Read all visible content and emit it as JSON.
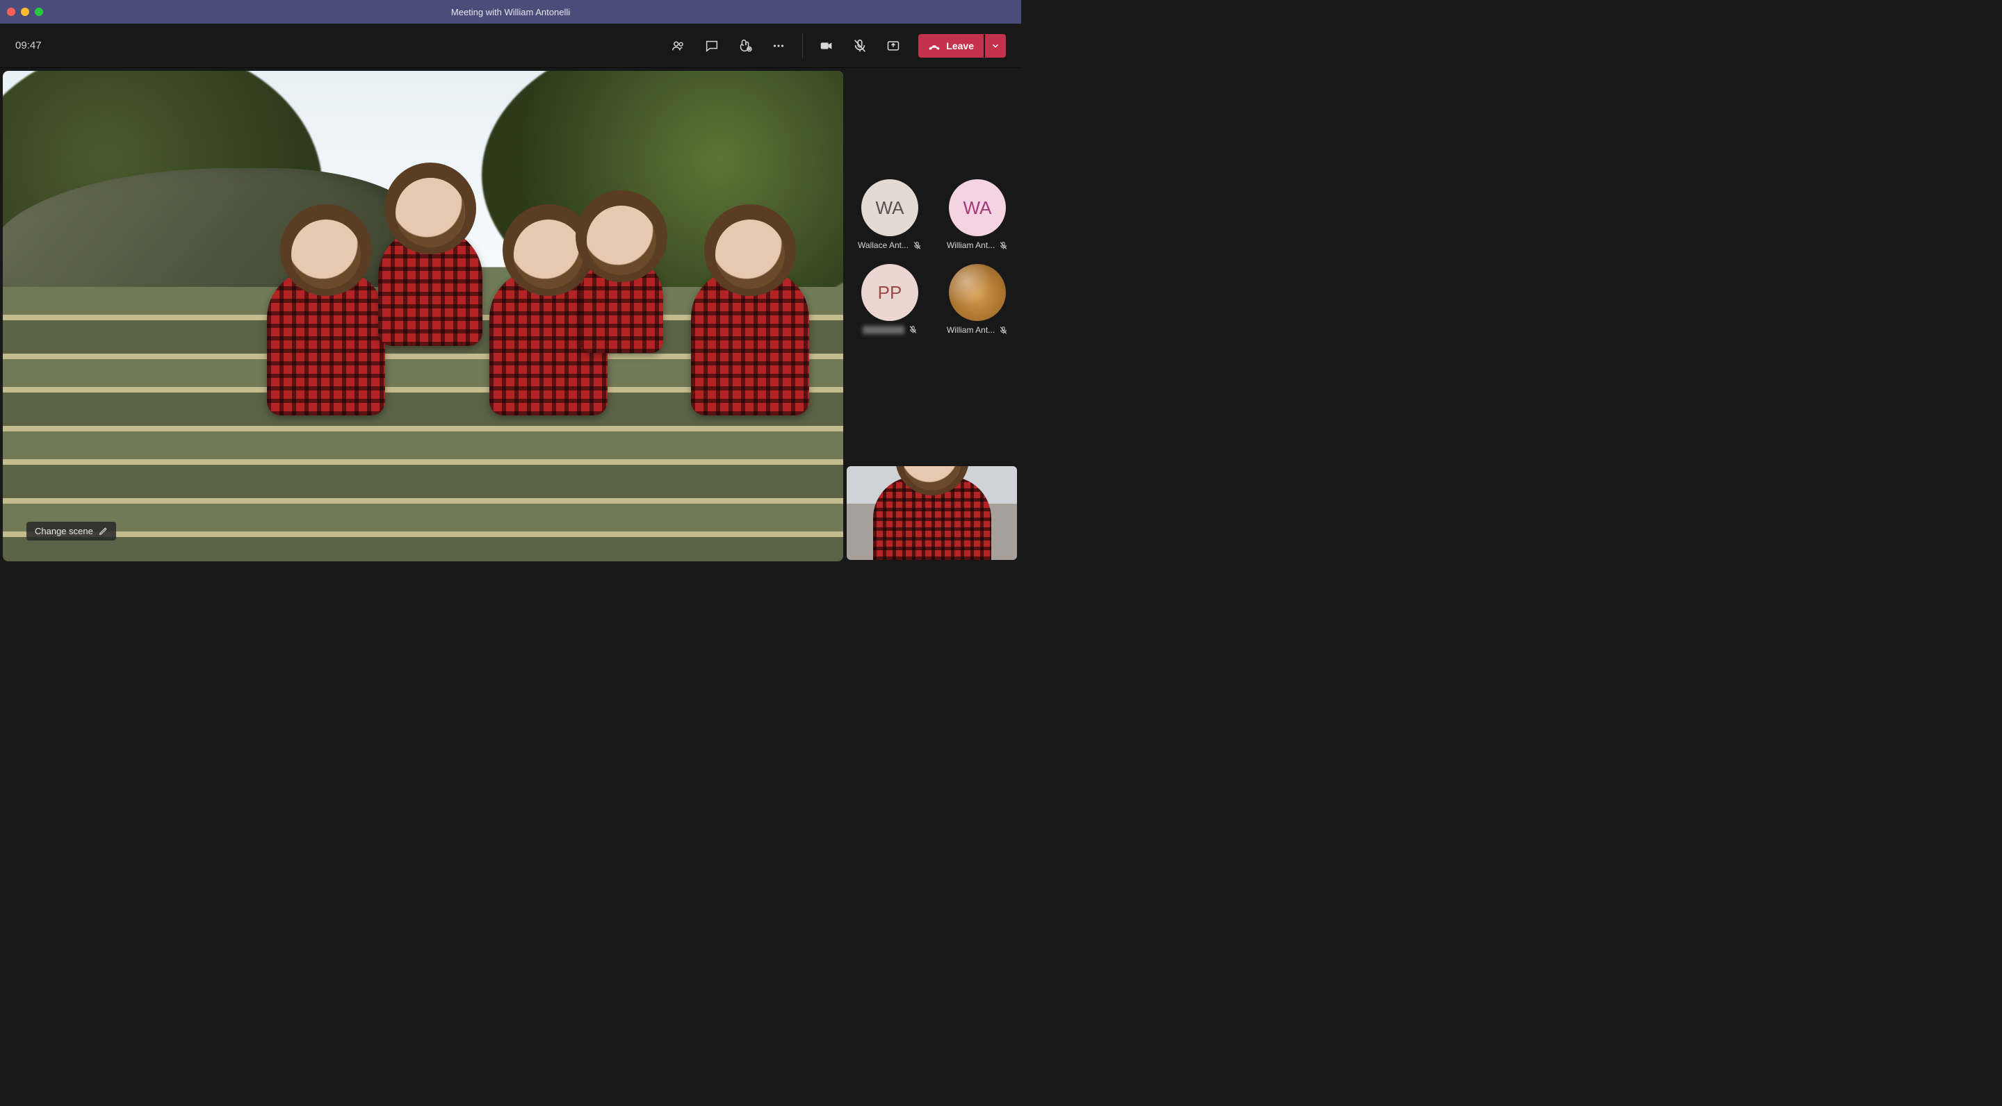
{
  "titlebar": {
    "title": "Meeting with William Antonelli"
  },
  "toolbar": {
    "timer": "09:47",
    "leave_label": "Leave"
  },
  "stage": {
    "change_scene_label": "Change scene"
  },
  "participants": [
    {
      "initials": "WA",
      "name": "Wallace Ant...",
      "avatar_bg": "#e3dbd3",
      "muted": true,
      "type": "initials"
    },
    {
      "initials": "WA",
      "name": "William Ant...",
      "avatar_bg": "#f4d3e2",
      "muted": true,
      "type": "initials"
    },
    {
      "initials": "PP",
      "name": "",
      "avatar_bg": "#ecd6d2",
      "muted": true,
      "type": "initials",
      "name_blurred": true
    },
    {
      "initials": "",
      "name": "William Ant...",
      "avatar_bg": "#d59a4a",
      "muted": true,
      "type": "image"
    }
  ]
}
